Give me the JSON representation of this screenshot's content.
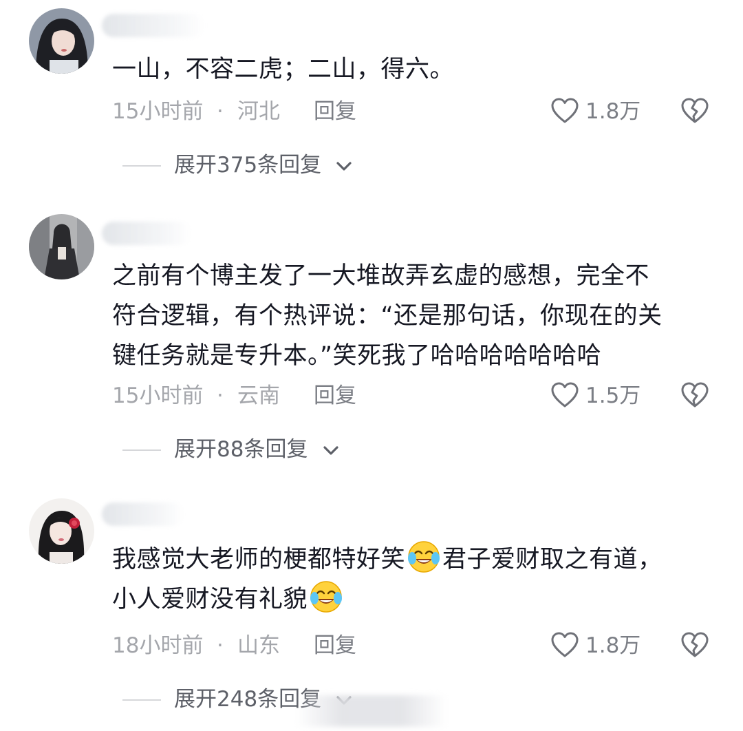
{
  "comments": [
    {
      "text": "一山，不容二虎；二山，得六。",
      "time": "15小时前",
      "location": "河北",
      "reply_label": "回复",
      "like_count": "1.8万",
      "expand_label": "展开375条回复"
    },
    {
      "text_lines": [
        "之前有个博主发了一大堆故弄玄虚的感想，完全不",
        "符合逻辑，有个热评说：“还是那句话，你现在的关",
        "键任务就是专升本。”笑死我了哈哈哈哈哈哈哈"
      ],
      "time": "15小时前",
      "location": "云南",
      "reply_label": "回复",
      "like_count": "1.5万",
      "expand_label": "展开88条回复"
    },
    {
      "text_line1_a": "我感觉大老师的梗都特好笑",
      "text_line1_b": "君子爱财取之有道，",
      "text_line2": "小人爱财没有礼貌",
      "time": "18小时前",
      "location": "山东",
      "reply_label": "回复",
      "like_count": "1.8万",
      "expand_label": "展开248条回复"
    }
  ],
  "separator_dot": "·",
  "icons": {
    "like": "heart-outline-icon",
    "dislike": "broken-heart-icon",
    "expand": "chevron-down-icon",
    "emoji": "tears-of-joy-emoji-icon"
  },
  "colors": {
    "text": "#161823",
    "meta": "#a4a6ab",
    "action": "#7b7e85"
  }
}
